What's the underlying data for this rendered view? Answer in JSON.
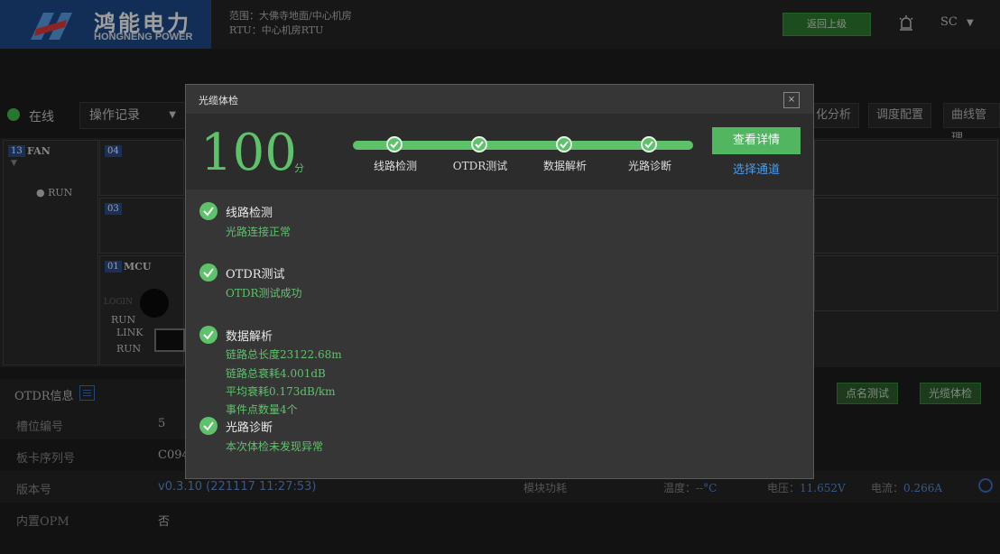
{
  "header": {
    "logo_cn": "鸿能电力",
    "logo_en": "HONGNENG POWER",
    "scope": "范围：大佛寺地面/中心机房",
    "rtu": "RTU：中心机房RTU",
    "back_label": "返回上级",
    "user": "SC",
    "logo_color": "#1d4a8c"
  },
  "toolbar": {
    "status": "在线",
    "oplog": "操作记录",
    "buttons": [
      "化分析",
      "调度配置",
      "曲线管理"
    ]
  },
  "rack": {
    "slots": [
      {
        "num": "13",
        "name": "FAN",
        "status": "RUN"
      },
      {
        "num": "04"
      },
      {
        "num": "03"
      },
      {
        "num": "01",
        "name": "MCU",
        "labels": [
          "LOGIN",
          "RUN",
          "LINK",
          "RUN"
        ]
      }
    ]
  },
  "otdr": {
    "title": "OTDR信息",
    "rows": [
      {
        "key": "槽位编号",
        "value": "5"
      },
      {
        "key": "板卡序列号",
        "value": "C094"
      },
      {
        "key": "版本号",
        "value": "v0.3.10 (221117 11:27:53)"
      },
      {
        "key": "内置OPM",
        "value": "否"
      }
    ],
    "module_power_label": "模块功耗",
    "temp_label": "温度：",
    "temp_value": "--°C",
    "voltage_label": "电压：",
    "voltage_value": "11.652V",
    "current_label": "电流：",
    "current_value": "0.266A",
    "actions": [
      "点名测试",
      "光缆体检"
    ]
  },
  "modal": {
    "title": "光缆体检",
    "close_label": "×",
    "score": "100",
    "score_unit": "分",
    "steps": [
      "线路检测",
      "OTDR测试",
      "数据解析",
      "光路诊断"
    ],
    "detail_label": "查看详情",
    "channel_label": "选择通道",
    "results": [
      {
        "title": "线路检测",
        "lines": [
          "光路连接正常"
        ]
      },
      {
        "title": "OTDR测试",
        "lines": [
          "OTDR测试成功"
        ]
      },
      {
        "title": "数据解析",
        "lines": [
          "链路总长度23122.68m",
          "链路总衰耗4.001dB",
          "平均衰耗0.173dB/km",
          "事件点数量4个"
        ]
      },
      {
        "title": "光路诊断",
        "lines": [
          "本次体检未发现异常"
        ]
      }
    ],
    "accent": "#5ec26b"
  }
}
